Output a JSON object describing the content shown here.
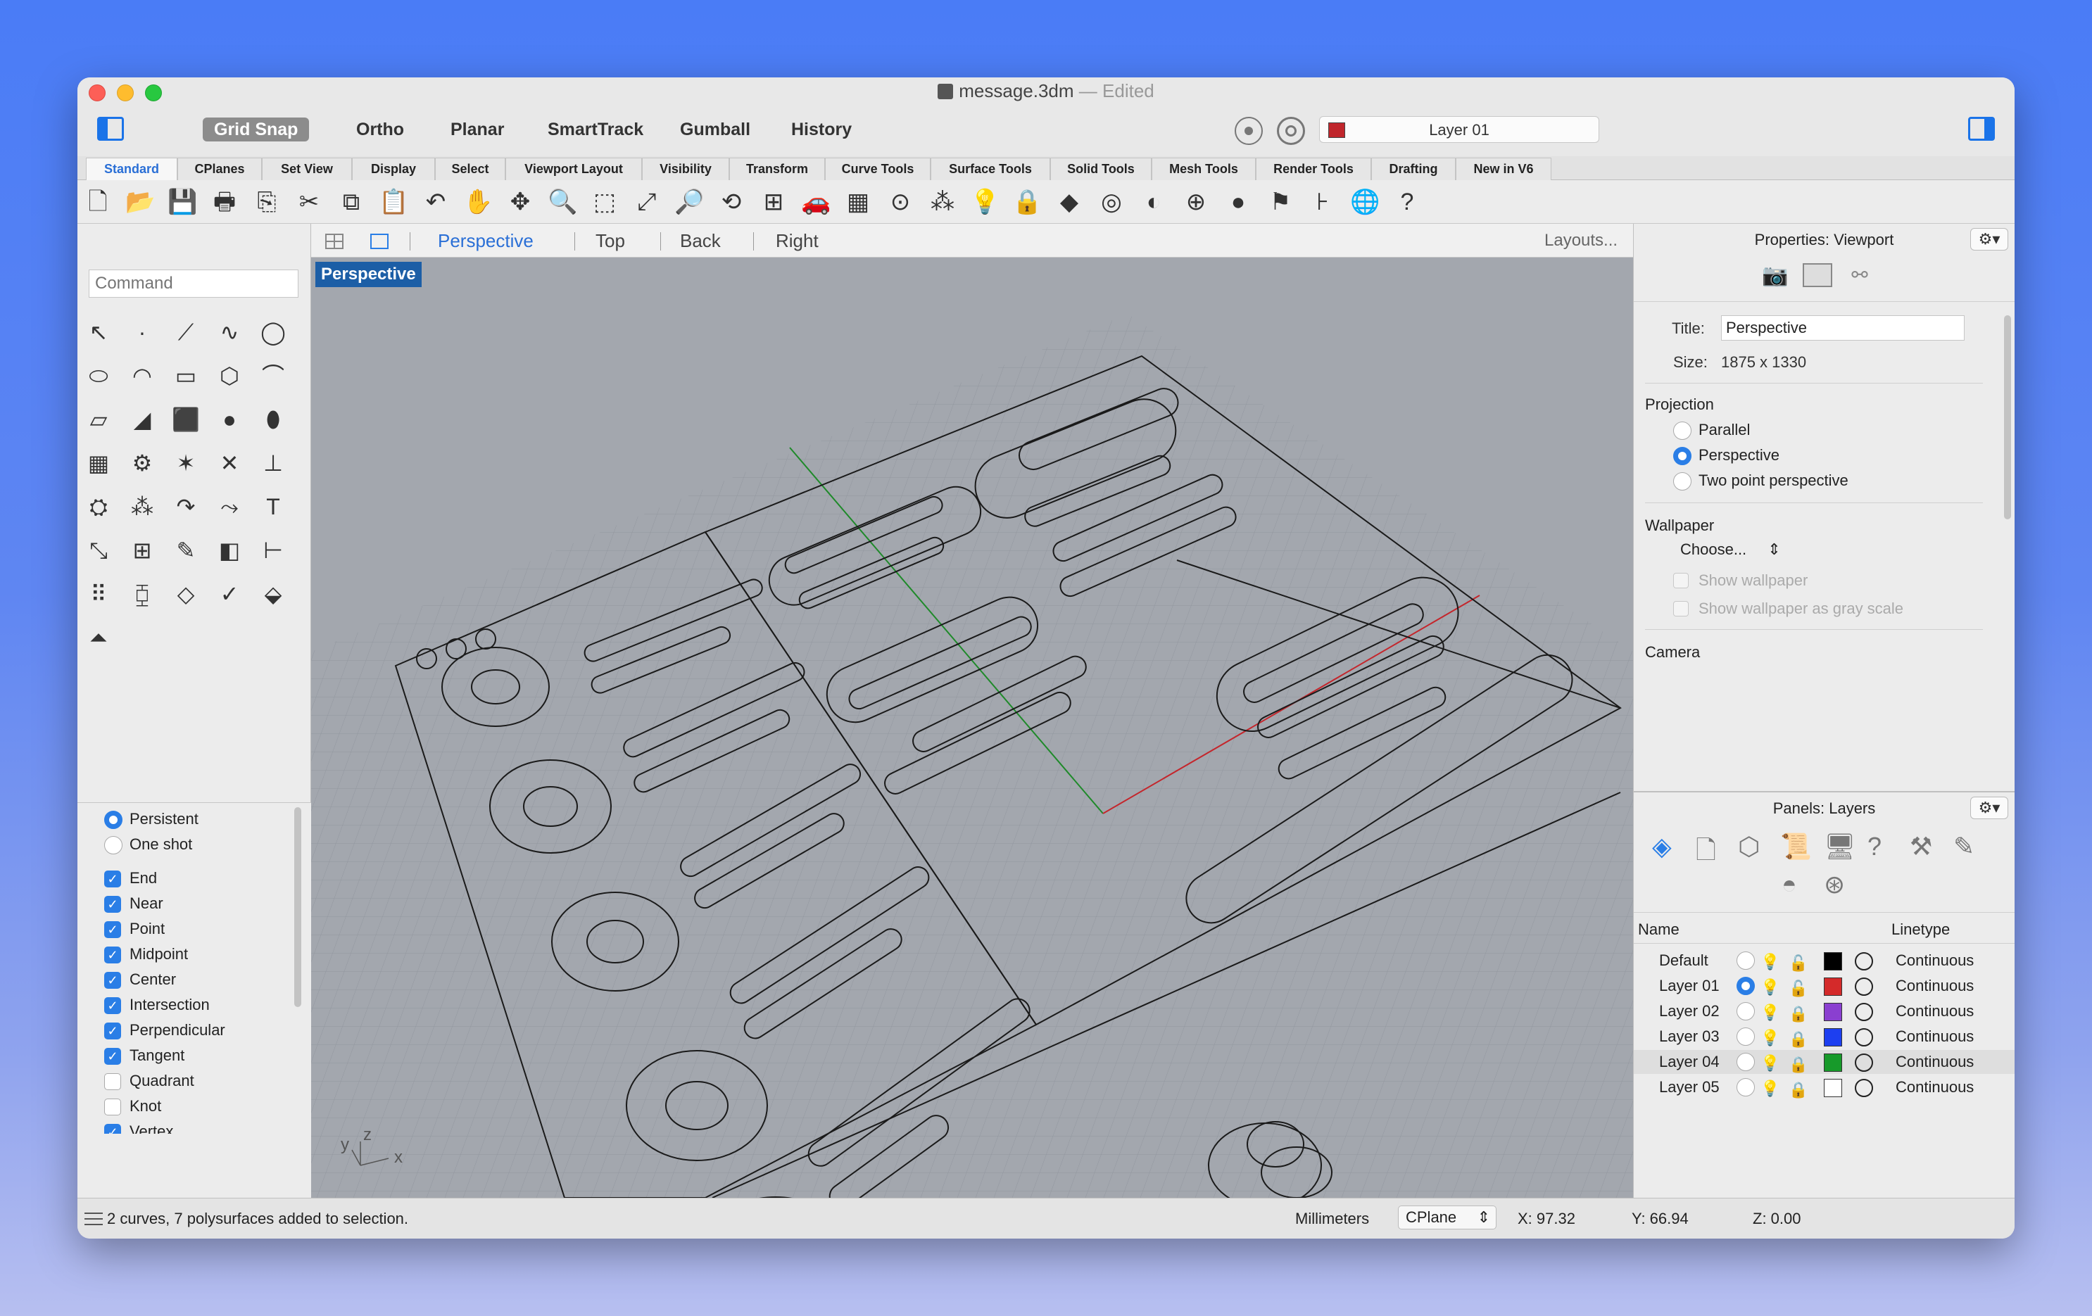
{
  "window": {
    "title": "message.3dm",
    "title_suffix": "— Edited"
  },
  "toolbar_modes": [
    "Grid Snap",
    "Ortho",
    "Planar",
    "SmartTrack",
    "Gumball",
    "History"
  ],
  "current_layer": "Layer 01",
  "tabs": [
    "Standard",
    "CPlanes",
    "Set View",
    "Display",
    "Select",
    "Viewport Layout",
    "Visibility",
    "Transform",
    "Curve Tools",
    "Surface Tools",
    "Solid Tools",
    "Mesh Tools",
    "Render Tools",
    "Drafting",
    "New in V6"
  ],
  "viewport_tabs": {
    "items": [
      "Perspective",
      "Top",
      "Back",
      "Right"
    ],
    "layouts": "Layouts..."
  },
  "viewport_label": "Perspective",
  "axis_labels": {
    "y": "y",
    "z": "z",
    "x": "x"
  },
  "command": {
    "placeholder": "Command"
  },
  "osnap": {
    "persistent": "Persistent",
    "one_shot": "One shot",
    "items": [
      {
        "label": "End",
        "checked": true
      },
      {
        "label": "Near",
        "checked": true
      },
      {
        "label": "Point",
        "checked": true
      },
      {
        "label": "Midpoint",
        "checked": true
      },
      {
        "label": "Center",
        "checked": true
      },
      {
        "label": "Intersection",
        "checked": true
      },
      {
        "label": "Perpendicular",
        "checked": true
      },
      {
        "label": "Tangent",
        "checked": true
      },
      {
        "label": "Quadrant",
        "checked": false
      },
      {
        "label": "Knot",
        "checked": false
      },
      {
        "label": "Vertex",
        "checked": true
      }
    ]
  },
  "properties": {
    "header": "Properties: Viewport",
    "title_label": "Title:",
    "title_value": "Perspective",
    "size_label": "Size:",
    "size_value": "1875 x 1330",
    "projection_label": "Projection",
    "projection_options": [
      "Parallel",
      "Perspective",
      "Two point perspective"
    ],
    "projection_selected": "Perspective",
    "wallpaper_label": "Wallpaper",
    "wallpaper_choose": "Choose...",
    "show_wallpaper": "Show wallpaper",
    "show_wallpaper_gray": "Show wallpaper as gray scale",
    "camera_label": "Camera"
  },
  "layers_panel": {
    "header": "Panels: Layers",
    "col_name": "Name",
    "col_linetype": "Linetype",
    "rows": [
      {
        "name": "Default",
        "color": "#000000",
        "linetype": "Continuous",
        "current": false
      },
      {
        "name": "Layer 01",
        "color": "#d42a2a",
        "linetype": "Continuous",
        "current": true
      },
      {
        "name": "Layer 02",
        "color": "#8a3fd0",
        "linetype": "Continuous",
        "current": false
      },
      {
        "name": "Layer 03",
        "color": "#1d3ff0",
        "linetype": "Continuous",
        "current": false
      },
      {
        "name": "Layer 04",
        "color": "#179a2a",
        "linetype": "Continuous",
        "current": false
      },
      {
        "name": "Layer 05",
        "color": "#ffffff",
        "linetype": "Continuous",
        "current": false
      }
    ]
  },
  "statusbar": {
    "message": "2 curves, 7 polysurfaces added to selection.",
    "units": "Millimeters",
    "cplane": "CPlane",
    "x": "X: 97.32",
    "y": "Y: 66.94",
    "z": "Z: 0.00"
  },
  "colors": {
    "accent": "#2a7ee6",
    "viewport_bg": "#a3a7ae",
    "viewport_label_bg": "#1c5ea6"
  }
}
